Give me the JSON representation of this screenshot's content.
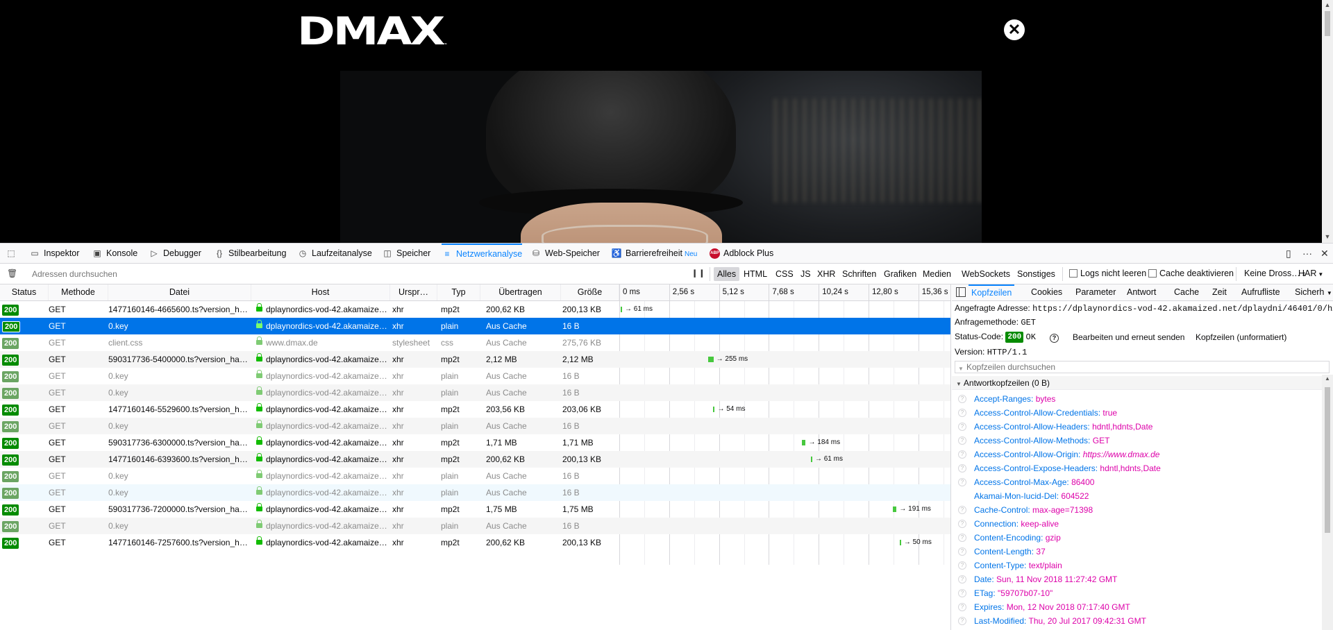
{
  "page": {
    "logo_text": "DMAX",
    "logo_tm": "™",
    "close_symbol": "✕"
  },
  "devtools": {
    "tabs": [
      {
        "label": "Inspektor",
        "icon": "inspector-icon"
      },
      {
        "label": "Konsole",
        "icon": "console-icon"
      },
      {
        "label": "Debugger",
        "icon": "debugger-icon"
      },
      {
        "label": "Stilbearbeitung",
        "icon": "style-editor-icon"
      },
      {
        "label": "Laufzeitanalyse",
        "icon": "performance-icon"
      },
      {
        "label": "Speicher",
        "icon": "memory-icon"
      },
      {
        "label": "Netzwerkanalyse",
        "icon": "network-icon",
        "selected": true
      },
      {
        "label": "Web-Speicher",
        "icon": "storage-icon"
      },
      {
        "label": "Barrierefreiheit",
        "icon": "accessibility-icon",
        "badge": "Neu"
      },
      {
        "label": "Adblock Plus",
        "icon": "adblock-icon",
        "icon_text": "ABP"
      }
    ],
    "right_controls": {
      "dock": "▯",
      "more": "···",
      "close": "✕"
    }
  },
  "filter_bar": {
    "search_placeholder": "Adressen durchsuchen",
    "pause_label": "❙❙",
    "types": [
      "Alles",
      "HTML",
      "CSS",
      "JS",
      "XHR",
      "Schriften",
      "Grafiken",
      "Medien",
      "WebSockets",
      "Sonstiges"
    ],
    "active_type": "Alles",
    "persist_logs_label": "Logs nicht leeren",
    "disable_cache_label": "Cache deaktivieren",
    "throttling_value": "Keine Dross…",
    "har_label": "HAR"
  },
  "table": {
    "columns": [
      "Status",
      "Methode",
      "Datei",
      "Host",
      "Urspr…",
      "Typ",
      "Übertragen",
      "Größe"
    ],
    "timeline_ticks": [
      "0 ms",
      "2,56 s",
      "5,12 s",
      "7,68 s",
      "10,24 s",
      "12,80 s",
      "15,36 s"
    ],
    "rows": [
      {
        "status": "200",
        "method": "GET",
        "file": "1477160146-4665600.ts?version_hash…",
        "host": "dplaynordics-vod-42.akamaize…",
        "cause": "xhr",
        "type": "mp2t",
        "transferred": "200,62 KB",
        "size": "200,13 KB",
        "cached": false,
        "wf_start_s": 0.0,
        "wf_dur_ms": 61,
        "wf_label": "61 ms"
      },
      {
        "status": "200",
        "method": "GET",
        "file": "0.key",
        "host": "dplaynordics-vod-42.akamaize…",
        "cause": "xhr",
        "type": "plain",
        "transferred": "Aus Cache",
        "size": "16 B",
        "cached": false,
        "selected": true
      },
      {
        "status": "200",
        "method": "GET",
        "file": "client.css",
        "host": "www.dmax.de",
        "cause": "stylesheet",
        "type": "css",
        "transferred": "Aus Cache",
        "size": "275,76 KB",
        "cached": true
      },
      {
        "status": "200",
        "method": "GET",
        "file": "590317736-5400000.ts?version_hash=…",
        "host": "dplaynordics-vod-42.akamaize…",
        "cause": "xhr",
        "type": "mp2t",
        "transferred": "2,12 MB",
        "size": "2,12 MB",
        "cached": false,
        "wf_start_s": 4.5,
        "wf_dur_ms": 255,
        "wf_label": "255 ms"
      },
      {
        "status": "200",
        "method": "GET",
        "file": "0.key",
        "host": "dplaynordics-vod-42.akamaize…",
        "cause": "xhr",
        "type": "plain",
        "transferred": "Aus Cache",
        "size": "16 B",
        "cached": true
      },
      {
        "status": "200",
        "method": "GET",
        "file": "0.key",
        "host": "dplaynordics-vod-42.akamaize…",
        "cause": "xhr",
        "type": "plain",
        "transferred": "Aus Cache",
        "size": "16 B",
        "cached": true
      },
      {
        "status": "200",
        "method": "GET",
        "file": "1477160146-5529600.ts?version_hash…",
        "host": "dplaynordics-vod-42.akamaize…",
        "cause": "xhr",
        "type": "mp2t",
        "transferred": "203,56 KB",
        "size": "203,06 KB",
        "cached": false,
        "wf_start_s": 4.75,
        "wf_dur_ms": 54,
        "wf_label": "54 ms"
      },
      {
        "status": "200",
        "method": "GET",
        "file": "0.key",
        "host": "dplaynordics-vod-42.akamaize…",
        "cause": "xhr",
        "type": "plain",
        "transferred": "Aus Cache",
        "size": "16 B",
        "cached": true
      },
      {
        "status": "200",
        "method": "GET",
        "file": "590317736-6300000.ts?version_hash=…",
        "host": "dplaynordics-vod-42.akamaize…",
        "cause": "xhr",
        "type": "mp2t",
        "transferred": "1,71 MB",
        "size": "1,71 MB",
        "cached": false,
        "wf_start_s": 9.3,
        "wf_dur_ms": 184,
        "wf_label": "184 ms"
      },
      {
        "status": "200",
        "method": "GET",
        "file": "1477160146-6393600.ts?version_hash…",
        "host": "dplaynordics-vod-42.akamaize…",
        "cause": "xhr",
        "type": "mp2t",
        "transferred": "200,62 KB",
        "size": "200,13 KB",
        "cached": false,
        "wf_start_s": 9.75,
        "wf_dur_ms": 61,
        "wf_label": "61 ms"
      },
      {
        "status": "200",
        "method": "GET",
        "file": "0.key",
        "host": "dplaynordics-vod-42.akamaize…",
        "cause": "xhr",
        "type": "plain",
        "transferred": "Aus Cache",
        "size": "16 B",
        "cached": true
      },
      {
        "status": "200",
        "method": "GET",
        "file": "0.key",
        "host": "dplaynordics-vod-42.akamaize…",
        "cause": "xhr",
        "type": "plain",
        "transferred": "Aus Cache",
        "size": "16 B",
        "cached": true,
        "hover": true
      },
      {
        "status": "200",
        "method": "GET",
        "file": "590317736-7200000.ts?version_hash=…",
        "host": "dplaynordics-vod-42.akamaize…",
        "cause": "xhr",
        "type": "mp2t",
        "transferred": "1,75 MB",
        "size": "1,75 MB",
        "cached": false,
        "wf_start_s": 13.95,
        "wf_dur_ms": 191,
        "wf_label": "191 ms"
      },
      {
        "status": "200",
        "method": "GET",
        "file": "0.key",
        "host": "dplaynordics-vod-42.akamaize…",
        "cause": "xhr",
        "type": "plain",
        "transferred": "Aus Cache",
        "size": "16 B",
        "cached": true
      },
      {
        "status": "200",
        "method": "GET",
        "file": "1477160146-7257600.ts?version_hash…",
        "host": "dplaynordics-vod-42.akamaize…",
        "cause": "xhr",
        "type": "mp2t",
        "transferred": "200,62 KB",
        "size": "200,13 KB",
        "cached": false,
        "wf_start_s": 14.3,
        "wf_dur_ms": 50,
        "wf_label": "50 ms"
      }
    ]
  },
  "side_panel": {
    "tabs": [
      "Kopfzeilen",
      "Cookies",
      "Parameter",
      "Antwort",
      "Cache",
      "Zeit",
      "Aufrufliste",
      "Sicherh"
    ],
    "selected_tab": "Kopfzeilen",
    "request_url_label": "Angefragte Adresse:",
    "request_url": "https://dplaynordics-vod-42.akamaized.net/dplaydni/46401/0/h…",
    "method_label": "Anfragemethode:",
    "method": "GET",
    "status_label": "Status-Code:",
    "status_code": "200",
    "status_text": "OK",
    "help_symbol": "?",
    "edit_resend_label": "Bearbeiten und erneut senden",
    "raw_headers_label": "Kopfzeilen (unformatiert)",
    "version_label": "Version:",
    "version": "HTTP/1.1",
    "header_search_placeholder": "Kopfzeilen durchsuchen",
    "response_headers_title": "Antwortkopfzeilen (0 B)",
    "response_headers": [
      {
        "name": "Accept-Ranges:",
        "value": "bytes"
      },
      {
        "name": "Access-Control-Allow-Credentials:",
        "value": "true"
      },
      {
        "name": "Access-Control-Allow-Headers:",
        "value": "hdntl,hdnts,Date"
      },
      {
        "name": "Access-Control-Allow-Methods:",
        "value": "GET"
      },
      {
        "name": "Access-Control-Allow-Origin:",
        "value": "https://www.dmax.de",
        "url": true
      },
      {
        "name": "Access-Control-Expose-Headers:",
        "value": "hdntl,hdnts,Date"
      },
      {
        "name": "Access-Control-Max-Age:",
        "value": "86400"
      },
      {
        "name": "Akamai-Mon-Iucid-Del:",
        "value": "604522",
        "no_help": true
      },
      {
        "name": "Cache-Control:",
        "value": "max-age=71398"
      },
      {
        "name": "Connection:",
        "value": "keep-alive"
      },
      {
        "name": "Content-Encoding:",
        "value": "gzip"
      },
      {
        "name": "Content-Length:",
        "value": "37"
      },
      {
        "name": "Content-Type:",
        "value": "text/plain"
      },
      {
        "name": "Date:",
        "value": "Sun, 11 Nov 2018 11:27:42 GMT"
      },
      {
        "name": "ETag:",
        "value": "\"59707b07-10\""
      },
      {
        "name": "Expires:",
        "value": "Mon, 12 Nov 2018 07:17:40 GMT"
      },
      {
        "name": "Last-Modified:",
        "value": "Thu, 20 Jul 2017 09:42:31 GMT"
      }
    ]
  },
  "colors": {
    "accent": "#0a84ff",
    "selected_row": "#0074e8",
    "status_ok": "#058b00",
    "waterfall": "#47c83e",
    "header_name": "#0074e8",
    "header_value": "#dd00a9"
  }
}
